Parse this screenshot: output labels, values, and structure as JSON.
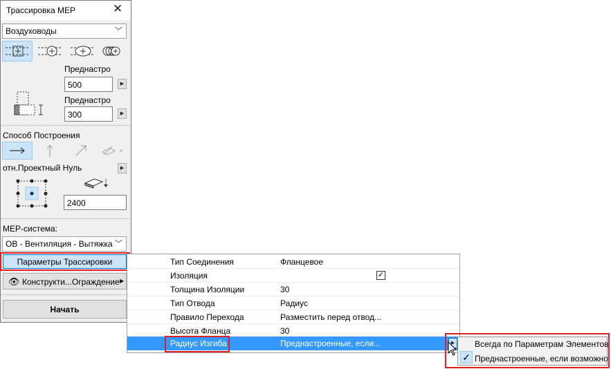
{
  "palette": {
    "title": "Трассировка MEP",
    "type_select": "Воздуховоды",
    "shape_icons": [
      "rectangular-duct-icon",
      "round-duct-icon",
      "oval-duct-icon",
      "flexible-duct-icon"
    ],
    "preset_label_1": "Преднастро",
    "width_value": "500",
    "preset_label_2": "Преднастро",
    "height_value": "300",
    "construction_method_label": "Способ Построения",
    "construction_icons": [
      "horizontal-arrow-icon",
      "vertical-arrow-icon",
      "diagonal-arrow-icon",
      "slope-arrow-icon"
    ],
    "reference_label": "отн.Проектный Нуль",
    "elevation_value": "2400",
    "mep_system_label": "МЕР-система:",
    "mep_system_value": "ОВ - Вентиляция - Вытяжка",
    "routing_params_button": "Параметры Трассировки",
    "constructions_button": "Конструкти...Ограждение",
    "start_button": "Начать"
  },
  "settings": {
    "rows": [
      {
        "key": "Тип Соединения",
        "value": "Фланцевое"
      },
      {
        "key": "Изоляция",
        "value": ""
      },
      {
        "key": "Толщина Изоляции",
        "value": "30"
      },
      {
        "key": "Тип Отвода",
        "value": "Радиус"
      },
      {
        "key": "Правило Перехода",
        "value": "Разместить перед отвод..."
      },
      {
        "key": "Высота Фланца",
        "value": "30"
      },
      {
        "key": "Радиус Изгиба",
        "value": "Преднастроенные, если..."
      }
    ],
    "insulation_checked": true
  },
  "popup_menu": {
    "items": [
      {
        "label": "Всегда по Параметрам Элементов",
        "checked": false
      },
      {
        "label": "Преднастроенные, если возможно",
        "checked": true
      }
    ]
  },
  "colors": {
    "highlight": "#3399ff",
    "selected_icon_bg": "#cce4f7",
    "callout_red": "#e02020"
  }
}
